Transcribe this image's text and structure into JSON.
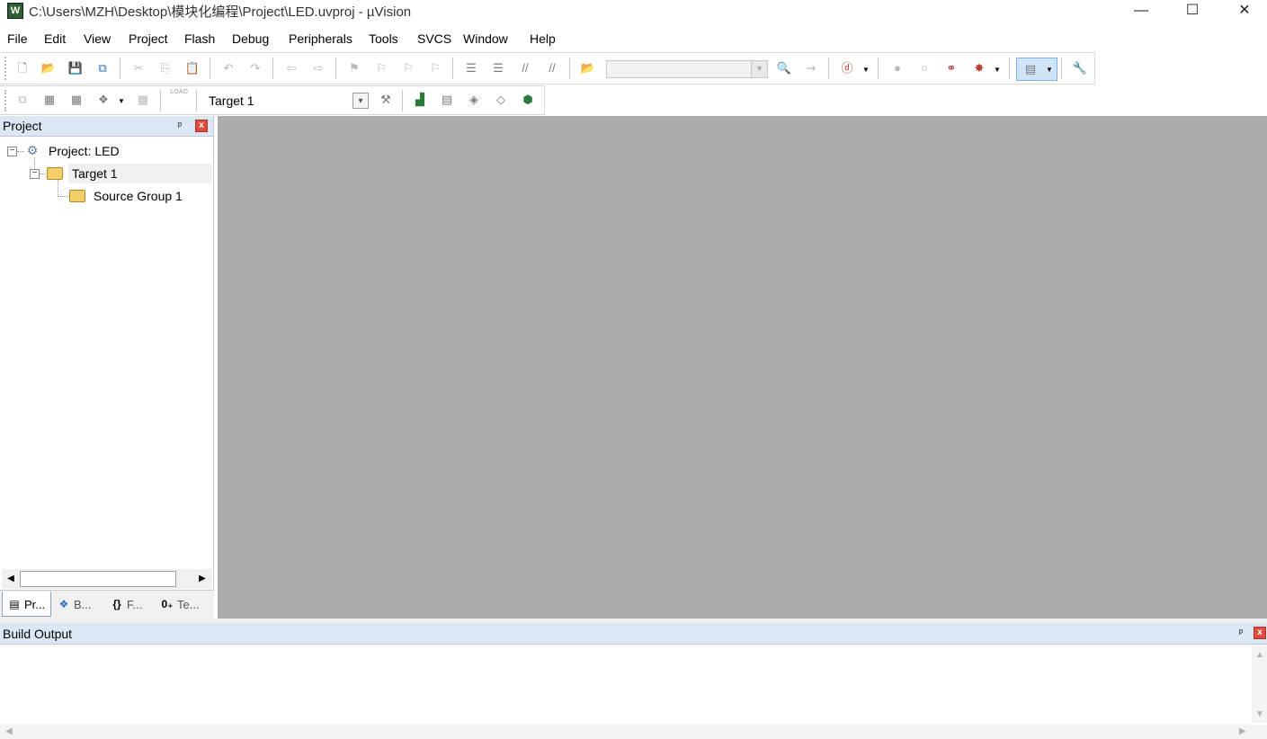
{
  "window": {
    "title": "C:\\Users\\MZH\\Desktop\\模块化编程\\Project\\LED.uvproj - µVision",
    "app_icon": "W",
    "minimize": "—",
    "maximize": "☐",
    "close": "✕"
  },
  "menu": [
    "File",
    "Edit",
    "View",
    "Project",
    "Flash",
    "Debug",
    "Peripherals",
    "Tools",
    "SVCS",
    "Window",
    "Help"
  ],
  "toolbar": {
    "find_combo_value": "",
    "target_combo_value": "Target 1",
    "load_label": "LOAD"
  },
  "project_panel": {
    "title": "Project",
    "pin": "ᵖ",
    "close": "x",
    "tree": {
      "root": "Project: LED",
      "target": "Target 1",
      "group": "Source Group 1"
    },
    "tabs": [
      {
        "label": "Pr...",
        "icon": "project-tab-icon",
        "glyph": "▤"
      },
      {
        "label": "B...",
        "icon": "books-tab-icon",
        "glyph": "❖"
      },
      {
        "label": "F...",
        "icon": "functions-tab-icon",
        "glyph": "{}"
      },
      {
        "label": "Te...",
        "icon": "templates-tab-icon",
        "glyph": "0₊"
      }
    ]
  },
  "build_output": {
    "title": "Build Output",
    "pin": "ᵖ",
    "close": "x"
  },
  "colors": {
    "editor_background": "#ababab",
    "panel_header": "#dbe8f4",
    "close_red": "#e04b3b",
    "highlight_blue": "#cfe5f7"
  }
}
